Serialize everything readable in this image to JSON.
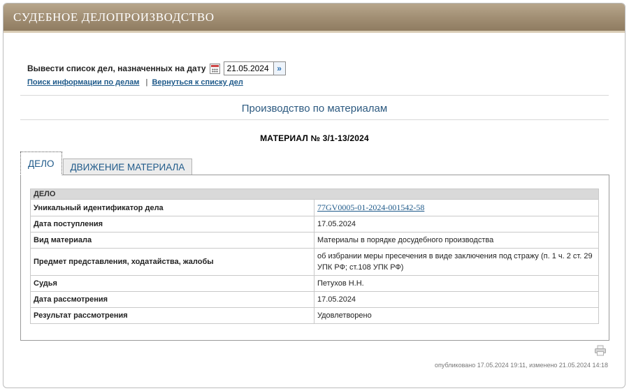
{
  "header": {
    "title": "СУДЕБНОЕ ДЕЛОПРОИЗВОДСТВО"
  },
  "date_filter": {
    "label": "Вывести список дел, назначенных на дату",
    "value": "21.05.2024",
    "go_glyph": "»"
  },
  "links": {
    "search": "Поиск информации по делам",
    "separator": "|",
    "back": "Вернуться к списку дел"
  },
  "section_title": "Производство по материалам",
  "material_title": "МАТЕРИАЛ № 3/1-13/2024",
  "tabs": [
    {
      "label": "ДЕЛО",
      "active": true
    },
    {
      "label": "ДВИЖЕНИЕ МАТЕРИАЛА",
      "active": false
    }
  ],
  "case_table": {
    "header": "ДЕЛО",
    "rows": [
      {
        "key": "Уникальный идентификатор дела",
        "value": "77GV0005-01-2024-001542-58",
        "link": true
      },
      {
        "key": "Дата поступления",
        "value": "17.05.2024"
      },
      {
        "key": "Вид материала",
        "value": "Материалы в порядке досудебного производства"
      },
      {
        "key": "Предмет представления, ходатайства, жалобы",
        "value": "об избрании меры пресечения в виде заключения под стражу (п. 1 ч. 2 ст. 29 УПК РФ; ст.108 УПК РФ)"
      },
      {
        "key": "Судья",
        "value": "Петухов Н.Н."
      },
      {
        "key": "Дата рассмотрения",
        "value": "17.05.2024"
      },
      {
        "key": "Результат рассмотрения",
        "value": "Удовлетворено"
      }
    ]
  },
  "footer": {
    "note": "опубликовано 17.05.2024 19:11, изменено 21.05.2024 14:18"
  },
  "colors": {
    "header_bg": "#a08d72",
    "link": "#1f5a8a",
    "section_title": "#2d5a80"
  }
}
